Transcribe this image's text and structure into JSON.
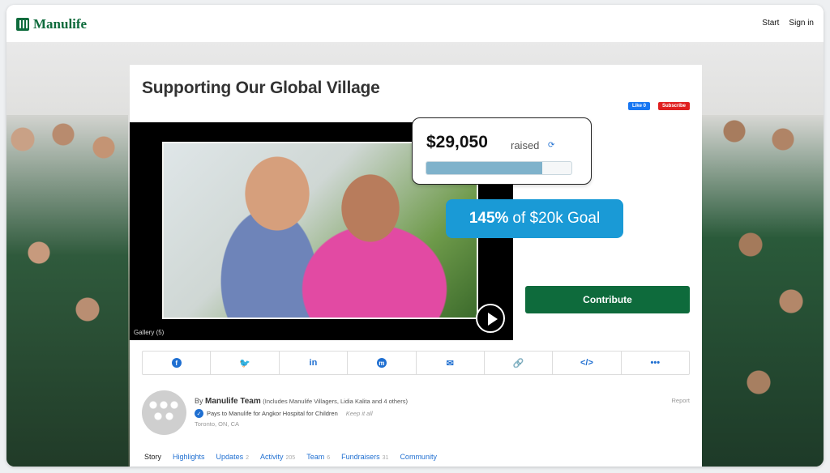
{
  "brand": {
    "name": "Manulife",
    "color": "#0e6b3c"
  },
  "nav": {
    "start": "Start",
    "sign_in": "Sign in"
  },
  "campaign": {
    "title": "Supporting Our Global Village",
    "fb_like": "Like 0",
    "yt_subscribe": "Subscribe",
    "gallery_label": "Gallery (5)"
  },
  "fundraising": {
    "raised_amount": "$29,050",
    "raised_word": "raised",
    "progress_fraction": 0.8,
    "goal_percent": "145%",
    "goal_text": "of $20k Goal",
    "contribute_label": "Contribute"
  },
  "share": {
    "items": [
      {
        "name": "facebook-icon",
        "glyph": "f"
      },
      {
        "name": "twitter-icon",
        "glyph": "🐦"
      },
      {
        "name": "linkedin-icon",
        "glyph": "in"
      },
      {
        "name": "messenger-icon",
        "glyph": "m"
      },
      {
        "name": "email-icon",
        "glyph": "✉"
      },
      {
        "name": "link-icon",
        "glyph": "🔗"
      },
      {
        "name": "embed-icon",
        "glyph": "</>"
      },
      {
        "name": "more-icon",
        "glyph": "•••"
      }
    ]
  },
  "organizer": {
    "by": "By",
    "team_name": "Manulife Team",
    "includes": "(Includes Manulife Villagers, Lidia Kalita and 4 others)",
    "pays_to": "Pays to Manulife for Angkor Hospital for Children",
    "keep_it": "Keep it all",
    "location": "Toronto, ON, CA",
    "report": "Report"
  },
  "tabs": [
    {
      "label": "Story",
      "count": ""
    },
    {
      "label": "Highlights",
      "count": ""
    },
    {
      "label": "Updates",
      "count": "2"
    },
    {
      "label": "Activity",
      "count": "205"
    },
    {
      "label": "Team",
      "count": "6"
    },
    {
      "label": "Fundraisers",
      "count": "31"
    },
    {
      "label": "Community",
      "count": ""
    }
  ],
  "colors": {
    "accent_blue": "#1a9ad6",
    "link_blue": "#1f6fd1",
    "progress": "#7fb2cb"
  }
}
